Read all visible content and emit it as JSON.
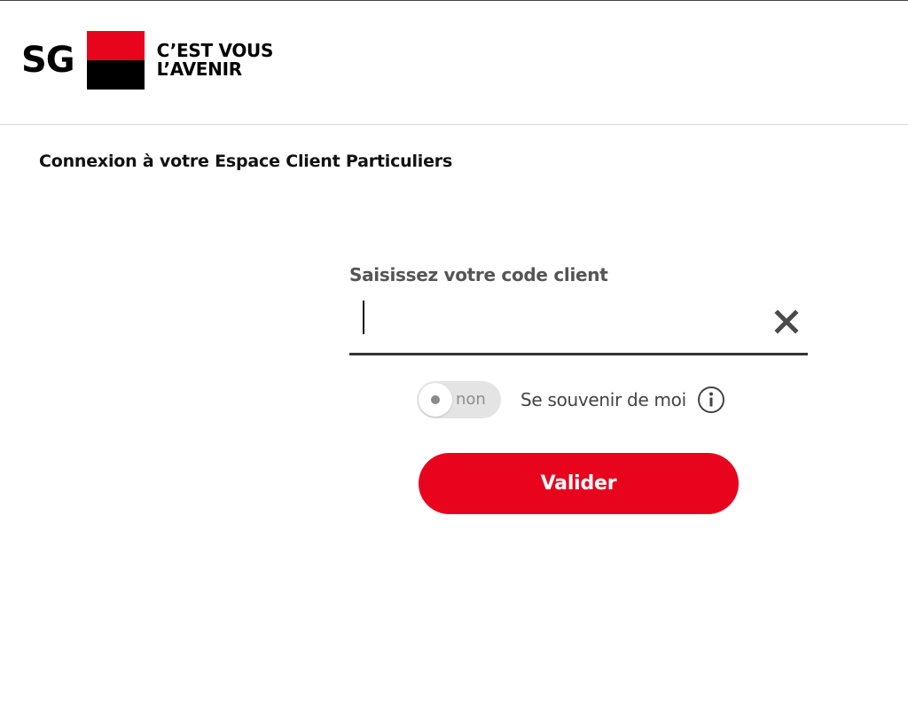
{
  "header": {
    "logo_text": "SG",
    "tagline_line1": "C’EST VOUS",
    "tagline_line2": "L’AVENIR"
  },
  "page_title": "Connexion à votre Espace Client Particuliers",
  "form": {
    "field_label": "Saisissez votre code client",
    "field_value": "",
    "field_placeholder": "",
    "toggle_state_label": "non",
    "remember_label": "Se souvenir de moi",
    "submit_label": "Valider"
  },
  "colors": {
    "brand_red": "#e9041e",
    "brand_black": "#000000",
    "toggle_bg": "#e4e4e4"
  },
  "icons": {
    "clear": "close-icon",
    "info": "info-icon"
  }
}
